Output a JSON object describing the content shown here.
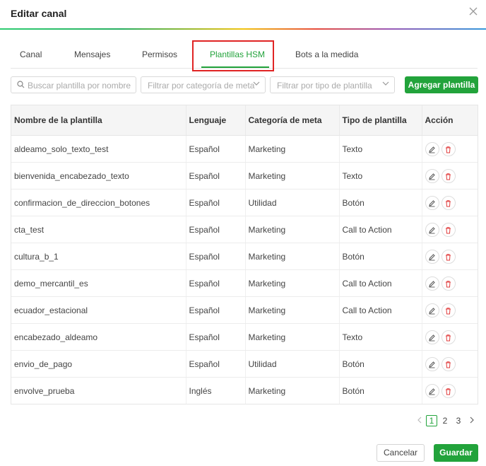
{
  "dialog": {
    "title": "Editar canal",
    "close_icon": "close-icon"
  },
  "tabs": [
    {
      "label": "Canal"
    },
    {
      "label": "Mensajes"
    },
    {
      "label": "Permisos"
    },
    {
      "label": "Plantillas HSM",
      "active": true
    },
    {
      "label": "Bots a la medida"
    }
  ],
  "filters": {
    "search_placeholder": "Buscar plantilla por nombre",
    "meta_category_placeholder": "Filtrar por categoría de meta",
    "template_type_placeholder": "Filtrar por tipo de plantilla",
    "add_button": "Agregar plantilla"
  },
  "table": {
    "headers": [
      "Nombre de la plantilla",
      "Lenguaje",
      "Categoría de meta",
      "Tipo de plantilla",
      "Acción"
    ],
    "rows": [
      [
        "aldeamo_solo_texto_test",
        "Español",
        "Marketing",
        "Texto"
      ],
      [
        "bienvenida_encabezado_texto",
        "Español",
        "Marketing",
        "Texto"
      ],
      [
        "confirmacion_de_direccion_botones",
        "Español",
        "Utilidad",
        "Botón"
      ],
      [
        "cta_test",
        "Español",
        "Marketing",
        "Call to Action"
      ],
      [
        "cultura_b_1",
        "Español",
        "Marketing",
        "Botón"
      ],
      [
        "demo_mercantil_es",
        "Español",
        "Marketing",
        "Call to Action"
      ],
      [
        "ecuador_estacional",
        "Español",
        "Marketing",
        "Call to Action"
      ],
      [
        "encabezado_aldeamo",
        "Español",
        "Marketing",
        "Texto"
      ],
      [
        "envio_de_pago",
        "Español",
        "Utilidad",
        "Botón"
      ],
      [
        "envolve_prueba",
        "Inglés",
        "Marketing",
        "Botón"
      ]
    ]
  },
  "pagination": {
    "pages": [
      "1",
      "2",
      "3"
    ],
    "current": "1"
  },
  "footer": {
    "cancel": "Cancelar",
    "save": "Guardar"
  },
  "colors": {
    "accent": "#22a33b",
    "highlight": "#e02424",
    "delete": "#e03b3b"
  }
}
